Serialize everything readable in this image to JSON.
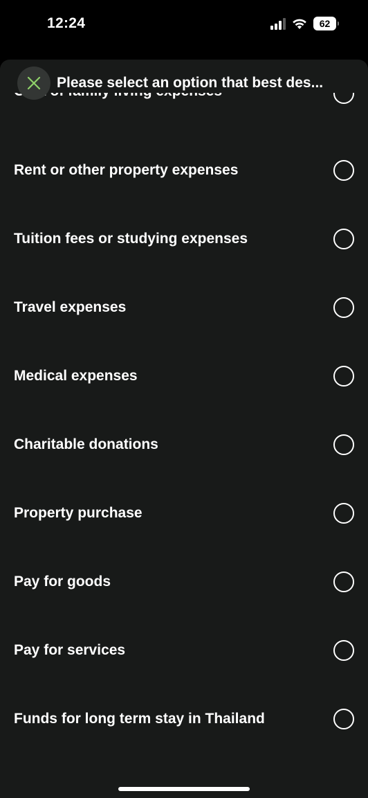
{
  "status_bar": {
    "time": "12:24",
    "battery": "62"
  },
  "header": {
    "title": "Please select an option that best des..."
  },
  "partial_option": {
    "label": "Cost of family living expenses"
  },
  "options": [
    {
      "label": "Rent or other property expenses",
      "selected": false
    },
    {
      "label": "Tuition fees or studying expenses",
      "selected": false
    },
    {
      "label": "Travel expenses",
      "selected": false
    },
    {
      "label": "Medical expenses",
      "selected": false
    },
    {
      "label": "Charitable donations",
      "selected": false
    },
    {
      "label": "Property purchase",
      "selected": false
    },
    {
      "label": "Pay for goods",
      "selected": false
    },
    {
      "label": "Pay for services",
      "selected": false
    },
    {
      "label": "Funds for long term stay in Thailand",
      "selected": false
    }
  ],
  "colors": {
    "background": "#000000",
    "sheet": "#181a19",
    "accent": "#8fd16a"
  }
}
